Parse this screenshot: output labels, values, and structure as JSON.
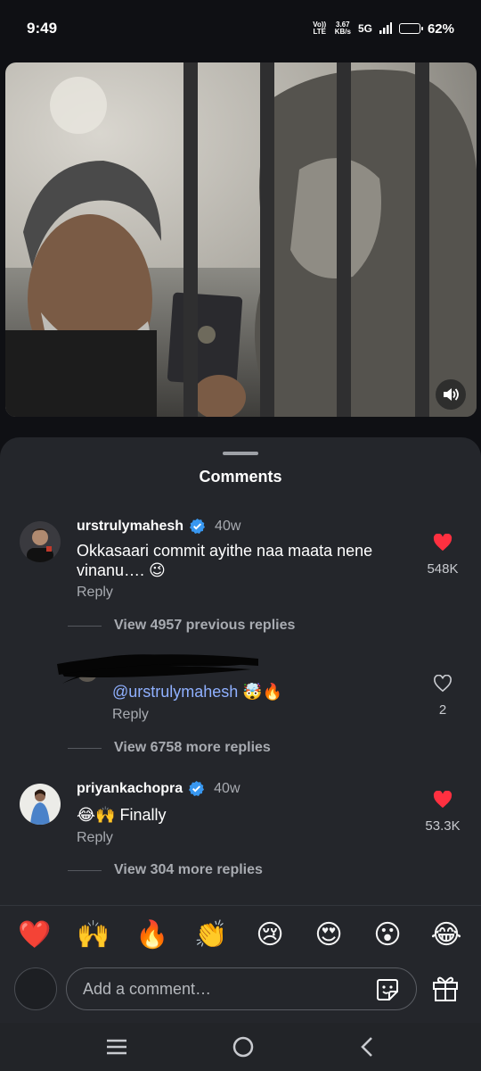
{
  "status": {
    "time": "9:49",
    "volte": "Vo)) LTE",
    "speed_value": "3.67",
    "speed_unit": "KB/s",
    "network": "5G",
    "battery_pct": "62%",
    "battery_level": 0.62
  },
  "media": {
    "icons": [
      "volume-icon"
    ]
  },
  "sheet": {
    "title": "Comments"
  },
  "comments": [
    {
      "username": "urstrulymahesh",
      "age": "40w",
      "text": "Okkasaari commit ayithe naa maata nene vinanu…. 😉",
      "reply": "Reply",
      "likes": "548K",
      "liked": true,
      "view_replies": "View 4957 previous replies"
    },
    {
      "username": "",
      "mention": "@urstrulymahesh",
      "text_suffix": " 🤯🔥",
      "reply": "Reply",
      "likes": "2",
      "liked": false,
      "view_replies": "View 6758 more replies"
    },
    {
      "username": "priyankachopra",
      "age": "40w",
      "text": "😂🙌 Finally",
      "reply": "Reply",
      "likes": "53.3K",
      "liked": true,
      "view_replies": "View 304 more replies"
    }
  ],
  "emoji_bar": [
    "❤️",
    "🙌",
    "🔥",
    "👏",
    "😢",
    "😍",
    "😮",
    "😂"
  ],
  "compose": {
    "placeholder": "Add a comment…"
  },
  "colors": {
    "like_red": "#ff3040",
    "verified_blue": "#3897f0",
    "sheet_bg": "#24262b"
  }
}
